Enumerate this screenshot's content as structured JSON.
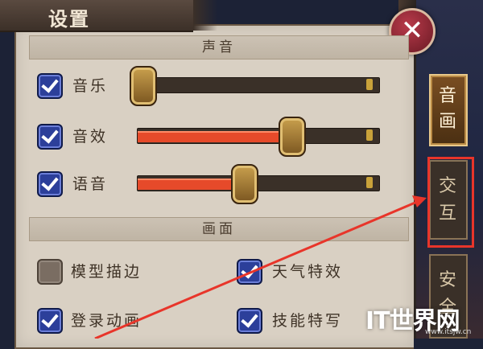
{
  "title": "设置",
  "close_glyph": "✕",
  "sections": {
    "sound": "声音",
    "display": "画面"
  },
  "sound": {
    "music": {
      "label": "音乐",
      "checked": true,
      "level": 0.0
    },
    "sfx": {
      "label": "音效",
      "checked": true,
      "level": 0.66
    },
    "voice": {
      "label": "语音",
      "checked": true,
      "level": 0.45
    }
  },
  "display": {
    "model_outline": {
      "label": "模型描边",
      "checked": false
    },
    "weather_effects": {
      "label": "天气特效",
      "checked": true
    },
    "login_animation": {
      "label": "登录动画",
      "checked": true
    },
    "skill_closeup": {
      "label": "技能特写",
      "checked": true
    }
  },
  "tabs": [
    {
      "label": "音画",
      "active": true
    },
    {
      "label": "交互",
      "active": false
    },
    {
      "label": "安全",
      "active": false
    }
  ],
  "watermark": {
    "text": "IT世界网",
    "sub": "www.itsjw.cn"
  },
  "colors": {
    "accent_red": "#e8352a",
    "checkbox_blue": "#2c3f9a",
    "slider_fill": "#e64a2a"
  }
}
